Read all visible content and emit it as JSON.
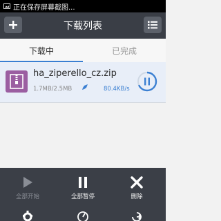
{
  "status_bar": {
    "text": "正在保存屏幕截图..."
  },
  "title_bar": {
    "title": "下载列表"
  },
  "tabs": [
    {
      "label": "下载中",
      "active": true
    },
    {
      "label": "已完成",
      "active": false
    }
  ],
  "download_item": {
    "file_name": "ha_ziperello_cz.zip",
    "size": "1.7MB/2.5MB",
    "speed": "80.4KB/s",
    "progress": 0.68
  },
  "bottom_menu": {
    "start_all": "全部开始",
    "pause_all": "全部暂停",
    "delete": "删除"
  },
  "colors": {
    "accent": "#3a7fd2",
    "title_bar": "#3a3e46",
    "file_icon": "#9b5ea1"
  }
}
